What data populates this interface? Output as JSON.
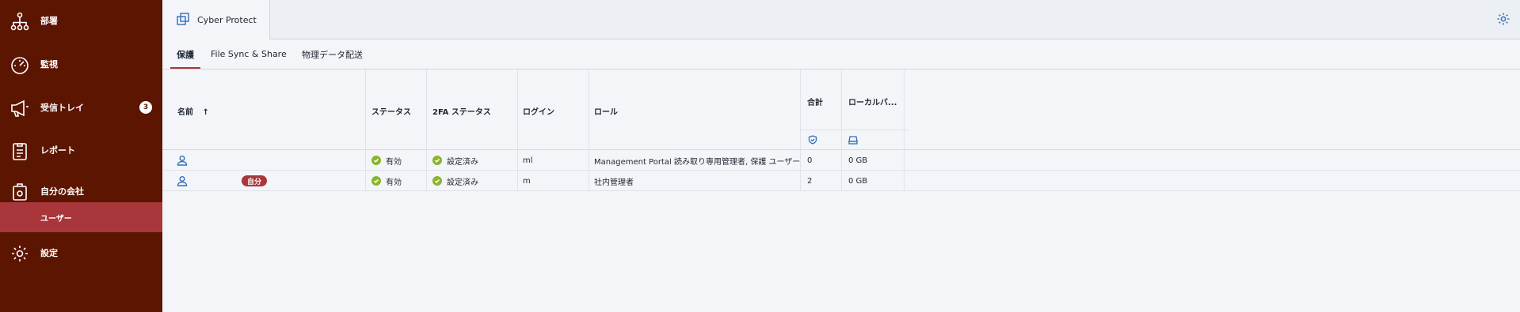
{
  "sidebar": {
    "items": [
      {
        "label": "部署",
        "icon": "org-chart-icon"
      },
      {
        "label": "監視",
        "icon": "speedometer-icon"
      },
      {
        "label": "受信トレイ",
        "icon": "megaphone-icon",
        "badge": "3"
      },
      {
        "label": "レポート",
        "icon": "clipboard-report-icon"
      },
      {
        "label": "自分の会社",
        "icon": "company-settings-icon"
      },
      {
        "label": "設定",
        "icon": "gear-icon"
      }
    ],
    "sub_item": {
      "label": "ユーザー"
    }
  },
  "header": {
    "app_tab": "Cyber Protect",
    "app_icon": "cyber-protect-icon",
    "settings_icon": "gear-icon"
  },
  "tabs": [
    {
      "label": "保護",
      "active": true
    },
    {
      "label": "File Sync & Share",
      "active": false
    },
    {
      "label": "物理データ配送",
      "active": false
    }
  ],
  "table": {
    "columns": {
      "name": "名前",
      "sort_indicator": "↑",
      "status": "ステータス",
      "twofa": "2FA ステータス",
      "login": "ログイン",
      "role": "ロール",
      "total": "合計",
      "local": "ローカルバ..."
    },
    "subheader_icons": [
      "shield-icon",
      "local-drive-icon"
    ],
    "rows": [
      {
        "status": "有効",
        "twofa": "設定済み",
        "login": "ml",
        "role": "Management Portal 読み取り専用管理者, 保護 ユーザー",
        "total": "0",
        "local": "0 GB",
        "self_badge": ""
      },
      {
        "status": "有効",
        "twofa": "設定済み",
        "login": "m",
        "role": "社内管理者",
        "total": "2",
        "local": "0 GB",
        "self_badge": "自分"
      }
    ]
  },
  "colors": {
    "sidebar_bg": "#5c1500",
    "accent": "#a8363a",
    "status_ok": "#8ab52c",
    "link_blue": "#2f6fba"
  }
}
